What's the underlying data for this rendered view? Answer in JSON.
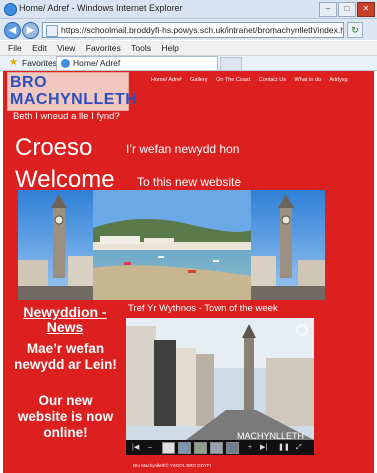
{
  "browser": {
    "window_title": "Home/ Adref - Windows Internet Explorer",
    "url": "https://schoolmail.broddyfi-hs.powys.sch.uk/intranet/bromachynlleth/index.html",
    "menu": [
      "File",
      "Edit",
      "View",
      "Favorites",
      "Tools",
      "Help"
    ],
    "favorites_label": "Favorites",
    "tab_title": "Home/ Adref"
  },
  "site": {
    "logo_line1": "BRO",
    "logo_line2": "MACHYNLLETH",
    "tagline": "Beth I wneud a lle I fynd?",
    "nav": [
      "Home/ Adref",
      "Gallery",
      "On The Coast",
      "Contact Us",
      "What to do",
      "Addysg"
    ],
    "welcome_cy": "Croeso",
    "welcome_cy_sub": "I’r wefan newydd hon",
    "welcome_en": "Welcome",
    "welcome_en_sub": "To this new website",
    "news_title": "Newyddion - News",
    "news_cy": "Mae’r wefan newydd ar Lein!",
    "news_en": "Our new website is now online!",
    "town_title": "Tref Yr Wythnos - Town of the week",
    "slide_caption": "MACHYNLLETH",
    "footer": "Bro Machynlleth© YSGOL BRO DDYFI"
  },
  "colors": {
    "page_bg": "#dc1f1f",
    "logo_text": "#2a4fbf"
  }
}
